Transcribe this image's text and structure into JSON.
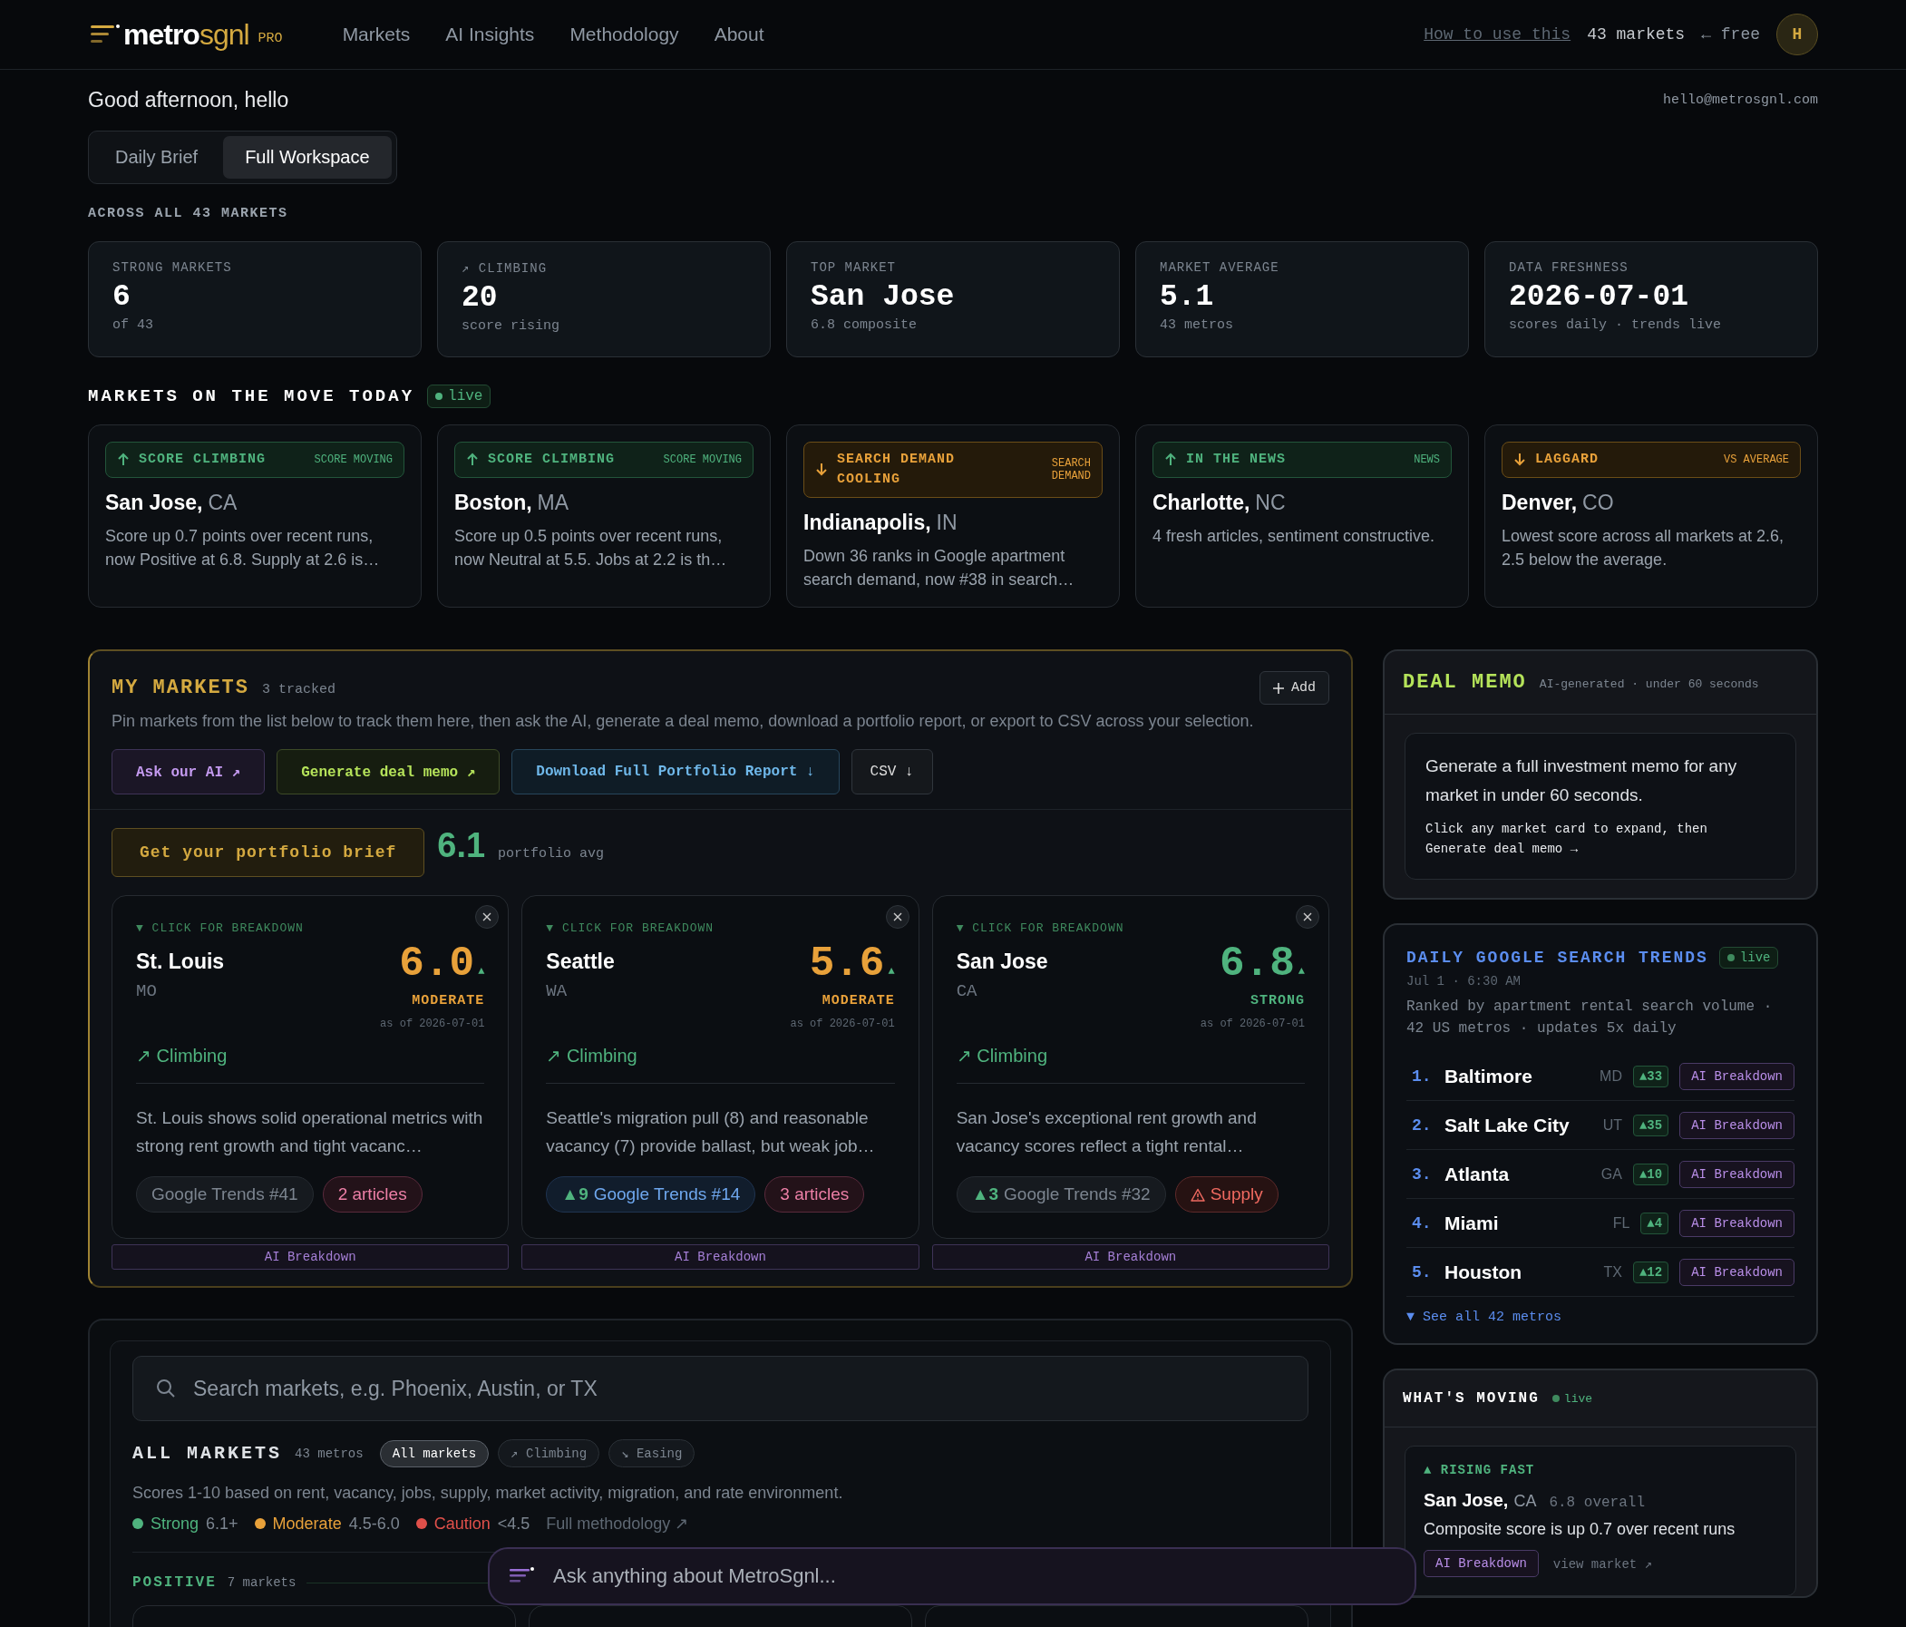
{
  "header": {
    "brand_main": "metro",
    "brand_accent": "sgnl",
    "brand_badge": "PRO",
    "nav": [
      "Markets",
      "AI Insights",
      "Methodology",
      "About"
    ],
    "help_link": "How to use this",
    "market_count": "43 markets",
    "plan": "← free",
    "avatar": "H"
  },
  "greeting": "Good afternoon, hello",
  "email": "hello@metrosgnl.com",
  "view_tabs": [
    {
      "label": "Daily Brief",
      "selected": false
    },
    {
      "label": "Full Workspace",
      "selected": true
    }
  ],
  "stats_label": "ACROSS ALL 43 MARKETS",
  "stats": [
    {
      "label": "STRONG MARKETS",
      "value": "6",
      "sub": "of 43"
    },
    {
      "label": "↗ CLIMBING",
      "value": "20",
      "sub": "score rising"
    },
    {
      "label": "TOP MARKET",
      "value": "San Jose",
      "sub": "6.8 composite"
    },
    {
      "label": "MARKET AVERAGE",
      "value": "5.1",
      "sub": "43 metros"
    },
    {
      "label": "DATA FRESHNESS",
      "value": "2026-07-01",
      "sub": "scores daily · trends live"
    }
  ],
  "movers": {
    "title": "MARKETS ON THE MOVE TODAY",
    "live": "live",
    "cards": [
      {
        "kind": "rising",
        "tag": "SCORE CLIMBING",
        "note": "SCORE MOVING",
        "city": "San Jose,",
        "state": "CA",
        "text": "Score up 0.7 points over recent runs, now Positive at 6.8. Supply at 2.6 is…"
      },
      {
        "kind": "rising",
        "tag": "SCORE CLIMBING",
        "note": "SCORE MOVING",
        "city": "Boston,",
        "state": "MA",
        "text": "Score up 0.5 points over recent runs, now Neutral at 5.5. Jobs at 2.2 is th…"
      },
      {
        "kind": "falling",
        "tag": "SEARCH DEMAND COOLING",
        "note": "SEARCH DEMAND",
        "city": "Indianapolis,",
        "state": "IN",
        "text": "Down 36 ranks in Google apartment search demand, now #38 in search…"
      },
      {
        "kind": "rising",
        "tag": "IN THE NEWS",
        "note": "NEWS",
        "city": "Charlotte,",
        "state": "NC",
        "text": "4 fresh articles, sentiment constructive."
      },
      {
        "kind": "falling",
        "tag": "LAGGARD",
        "note": "VS AVERAGE",
        "city": "Denver,",
        "state": "CO",
        "text": "Lowest score across all markets at 2.6, 2.5 below the average."
      }
    ]
  },
  "my_markets": {
    "title": "MY MARKETS",
    "count": "3 tracked",
    "add": "Add",
    "description": "Pin markets from the list below to track them here, then ask the AI, generate a deal memo, download a portfolio report, or export to CSV across your selection.",
    "actions": [
      {
        "kind": "ai",
        "label": "Ask our AI ↗"
      },
      {
        "kind": "memo",
        "label": "Generate deal memo ↗"
      },
      {
        "kind": "report",
        "label": "Download Full Portfolio Report ↓"
      },
      {
        "kind": "csv",
        "label": "CSV ↓"
      }
    ],
    "brief": "Get your portfolio brief",
    "avg": "6.1",
    "avg_label": "portfolio avg",
    "cards": [
      {
        "expand": "▼ CLICK FOR BREAKDOWN",
        "city": "St. Louis",
        "state": "MO",
        "score": "6.0",
        "arrow": "▲",
        "rating": "MODERATE",
        "color": "#e8a13a",
        "as_of": "as of 2026-07-01",
        "trend": "↗ Climbing",
        "summary": "St. Louis shows solid operational metrics with strong rent growth and tight vacanc…",
        "chips": [
          {
            "kind": "trends",
            "text": "Google Trends #41"
          },
          {
            "kind": "articles",
            "text": "2 articles"
          }
        ],
        "ai": "AI Breakdown"
      },
      {
        "expand": "▼ CLICK FOR BREAKDOWN",
        "city": "Seattle",
        "state": "WA",
        "score": "5.6",
        "arrow": "▲",
        "rating": "MODERATE",
        "color": "#e8a13a",
        "as_of": "as of 2026-07-01",
        "trend": "↗ Climbing",
        "summary": "Seattle's migration pull (8) and reasonable vacancy (7) provide ballast, but weak job…",
        "chips": [
          {
            "kind": "trends_hot",
            "delta": "▲9",
            "text": "Google Trends #14"
          },
          {
            "kind": "articles",
            "text": "3 articles"
          }
        ],
        "ai": "AI Breakdown"
      },
      {
        "expand": "▼ CLICK FOR BREAKDOWN",
        "city": "San Jose",
        "state": "CA",
        "score": "6.8",
        "arrow": "▲",
        "rating": "STRONG",
        "color": "#4fb37e",
        "as_of": "as of 2026-07-01",
        "trend": "↗ Climbing",
        "summary": "San Jose's exceptional rent growth and vacancy scores reflect a tight rental…",
        "chips": [
          {
            "kind": "trends",
            "delta": "▲3",
            "text": "Google Trends #32"
          },
          {
            "kind": "risk",
            "text": "Supply"
          }
        ],
        "ai": "AI Breakdown"
      }
    ]
  },
  "deal_memo": {
    "title": "DEAL MEMO",
    "note": "AI-generated · under 60 seconds",
    "text": "Generate a full investment memo for any market in under 60 seconds.",
    "hint": "Click any market card to expand, then Generate deal memo →"
  },
  "trends": {
    "title": "DAILY GOOGLE SEARCH TRENDS",
    "live": "live",
    "time": "Jul 1 · 6:30 AM",
    "description": "Ranked by apartment rental search volume · 42 US metros · updates 5x daily",
    "rows": [
      {
        "rank": "1.",
        "city": "Baltimore",
        "state": "MD",
        "delta": "▲33",
        "button": "AI Breakdown"
      },
      {
        "rank": "2.",
        "city": "Salt Lake City",
        "state": "UT",
        "delta": "▲35",
        "button": "AI Breakdown"
      },
      {
        "rank": "3.",
        "city": "Atlanta",
        "state": "GA",
        "delta": "▲10",
        "button": "AI Breakdown"
      },
      {
        "rank": "4.",
        "city": "Miami",
        "state": "FL",
        "delta": "▲4",
        "button": "AI Breakdown"
      },
      {
        "rank": "5.",
        "city": "Houston",
        "state": "TX",
        "delta": "▲12",
        "button": "AI Breakdown"
      }
    ],
    "see_all": "▼ See all 42 metros"
  },
  "whats_moving": {
    "title": "WHAT'S MOVING",
    "live": "live",
    "tag": "▲ RISING FAST",
    "city": "San Jose,",
    "state": "CA",
    "score": "6.8 overall",
    "text": "Composite score is up 0.7 over recent runs",
    "button": "AI Breakdown",
    "link": "view market ↗"
  },
  "all_markets": {
    "placeholder": "Search markets, e.g. Phoenix, Austin, or TX",
    "title": "ALL MARKETS",
    "count": "43 metros",
    "filters": [
      {
        "label": "All markets",
        "selected": true
      },
      {
        "label": "↗ Climbing",
        "selected": false
      },
      {
        "label": "↘ Easing",
        "selected": false
      }
    ],
    "description": "Scores 1-10 based on rent, vacancy, jobs, supply, market activity, migration, and rate environment.",
    "legend": [
      {
        "label": "Strong",
        "range": "6.1+",
        "color": "#4fb37e"
      },
      {
        "label": "Moderate",
        "range": "4.5-6.0",
        "color": "#e8a13a"
      },
      {
        "label": "Caution",
        "range": "<4.5",
        "color": "#e0504a"
      }
    ],
    "methodology": "Full methodology ↗",
    "group": "POSITIVE",
    "group_count": "7 markets"
  },
  "chat": {
    "placeholder": "Ask anything about MetroSgnl..."
  }
}
